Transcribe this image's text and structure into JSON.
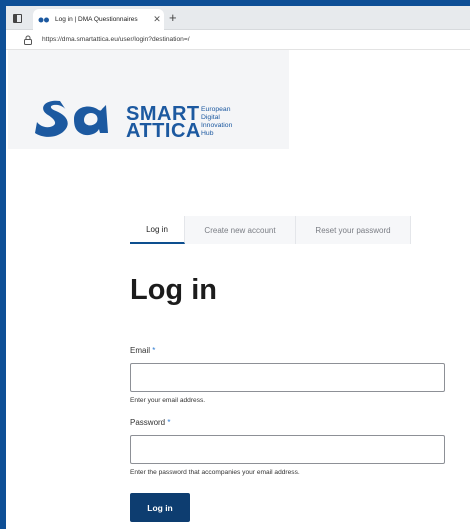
{
  "browser": {
    "tab_title": "Log in | DMA Questionnaires",
    "url": "https://dma.smartattica.eu/user/login?destination=/"
  },
  "logo": {
    "line1": "SMART",
    "line2": "ATTICA",
    "hub_line1": "European",
    "hub_line2": "Digital",
    "hub_line3": "Innovation",
    "hub_line4": "Hub",
    "brand_color": "#1c59a0"
  },
  "tabs": [
    {
      "label": "Log in",
      "active": true
    },
    {
      "label": "Create new account",
      "active": false
    },
    {
      "label": "Reset your password",
      "active": false
    }
  ],
  "page_title": "Log in",
  "form": {
    "email_label": "Email",
    "email_required": "*",
    "email_value": "",
    "email_hint": "Enter your email address.",
    "password_label": "Password",
    "password_required": "*",
    "password_value": "",
    "password_hint": "Enter the password that accompanies your email address.",
    "submit_label": "Log in"
  },
  "colors": {
    "desktop_background": "#0e4f96",
    "button": "#0d3d70",
    "active_tab_underline": "#0d4f8f"
  }
}
